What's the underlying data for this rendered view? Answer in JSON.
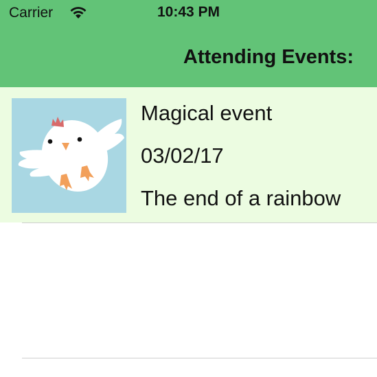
{
  "status_bar": {
    "carrier": "Carrier",
    "time": "10:43 PM"
  },
  "nav": {
    "title": "Attending Events:"
  },
  "events": [
    {
      "name": "Magical event",
      "date": "03/02/17",
      "location": "The end of a rainbow",
      "image_icon": "white-chick-icon"
    }
  ],
  "colors": {
    "header": "#62c377",
    "row_background": "#ecfce1",
    "thumb_background": "#a9d7e3"
  }
}
